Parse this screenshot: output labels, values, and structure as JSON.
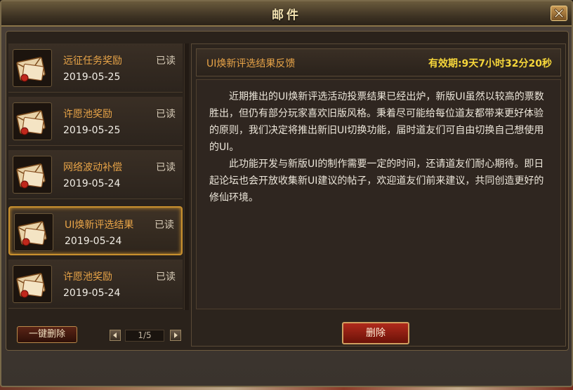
{
  "window": {
    "title": "邮件"
  },
  "mail_list": [
    {
      "subject": "远征任务奖励",
      "status": "已读",
      "date": "2019-05-25",
      "selected": false
    },
    {
      "subject": "许愿池奖励",
      "status": "已读",
      "date": "2019-05-25",
      "selected": false
    },
    {
      "subject": "网络波动补偿",
      "status": "已读",
      "date": "2019-05-24",
      "selected": false
    },
    {
      "subject": "UI焕新评选结果",
      "status": "已读",
      "date": "2019-05-24",
      "selected": true
    },
    {
      "subject": "许愿池奖励",
      "status": "已读",
      "date": "2019-05-24",
      "selected": false
    }
  ],
  "list_controls": {
    "bulk_delete_label": "一键删除",
    "page": "1/5"
  },
  "detail": {
    "title": "UI焕新评选结果反馈",
    "validity": "有效期:9天7小时32分20秒",
    "paragraphs": [
      "近期推出的UI焕新评选活动投票结果已经出炉，新版UI虽然以较高的票数胜出，但仍有部分玩家喜欢旧版风格。秉着尽可能给每位道友都带来更好体验的原则，我们决定将推出新旧UI切换功能，届时道友们可自由切换自己想使用的UI。",
      "此功能开发与新版UI的制作需要一定的时间，还请道友们耐心期待。即日起论坛也会开放收集新UI建议的帖子，欢迎道友们前来建议，共同创造更好的修仙环境。"
    ],
    "delete_label": "删除"
  },
  "colors": {
    "accent_orange": "#e8a448",
    "validity_yellow": "#f6d63a",
    "selected_border": "#c8902e",
    "delete_red": "#b02a1c"
  },
  "icons": {
    "mail_item": "envelope-icon",
    "close": "close-icon",
    "prev": "triangle-left-icon",
    "next": "triangle-right-icon"
  }
}
